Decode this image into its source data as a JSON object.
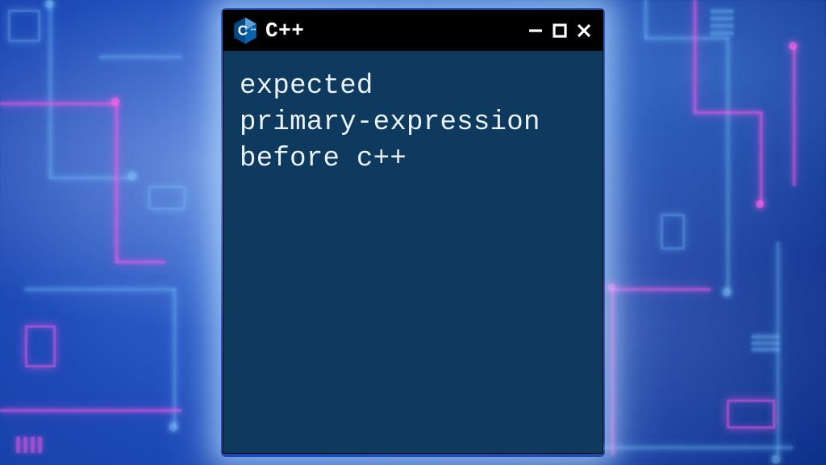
{
  "window": {
    "title": "C++",
    "logo_letter": "C",
    "logo_plus": "++",
    "controls": {
      "minimize": "minimize",
      "maximize": "maximize",
      "close": "close"
    }
  },
  "body": {
    "line1": "expected",
    "line2": "primary-expression",
    "line3": "before c++"
  },
  "colors": {
    "window_bg": "#0e3a5f",
    "titlebar_bg": "#000000",
    "text": "#eaf2f7",
    "logo_dark": "#024b87",
    "logo_light": "#5aa0db"
  }
}
